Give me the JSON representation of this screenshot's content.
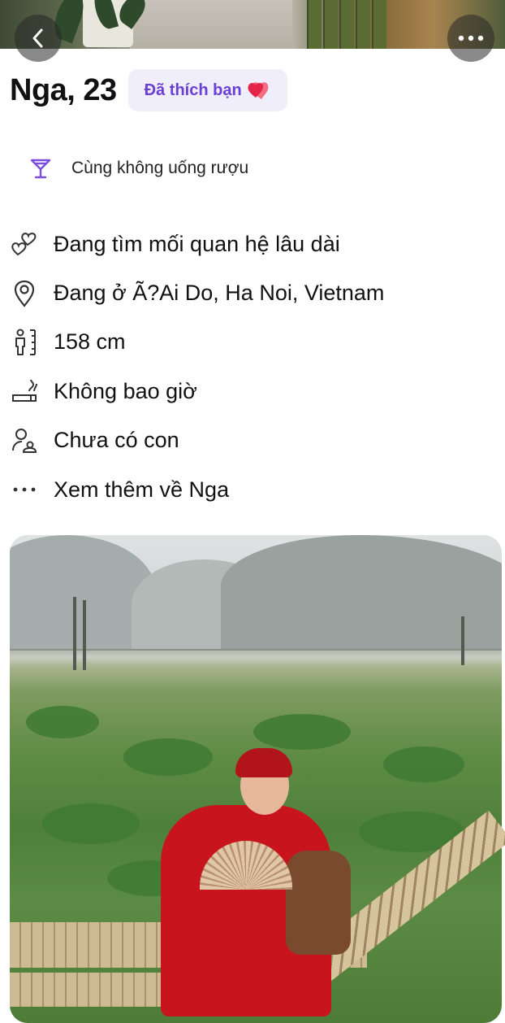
{
  "header": {
    "back_icon": "chevron-left-icon",
    "more_icon": "more-horizontal-icon"
  },
  "profile": {
    "name_age": "Nga, 23",
    "liked_badge": "Đã thích bạn",
    "liked_badge_icon": "two-hearts-icon"
  },
  "shared_interest": {
    "icon": "cocktail-glass-icon",
    "text": "Cùng không uống rượu"
  },
  "info": [
    {
      "icon": "hearts-outline-icon",
      "text": "Đang tìm mối quan hệ lâu dài"
    },
    {
      "icon": "location-pin-icon",
      "text": "Đang ở Ã?Ai Do, Ha Noi, Vietnam"
    },
    {
      "icon": "height-icon",
      "text": "158 cm"
    },
    {
      "icon": "cigarette-icon",
      "text": "Không bao giờ"
    },
    {
      "icon": "children-icon",
      "text": "Chưa có con"
    },
    {
      "icon": "more-dots-icon",
      "text": "Xem thêm về Nga"
    }
  ],
  "colors": {
    "accent": "#6a3fd3",
    "badge_bg": "#f1eefc",
    "heart": "#e4264a"
  }
}
